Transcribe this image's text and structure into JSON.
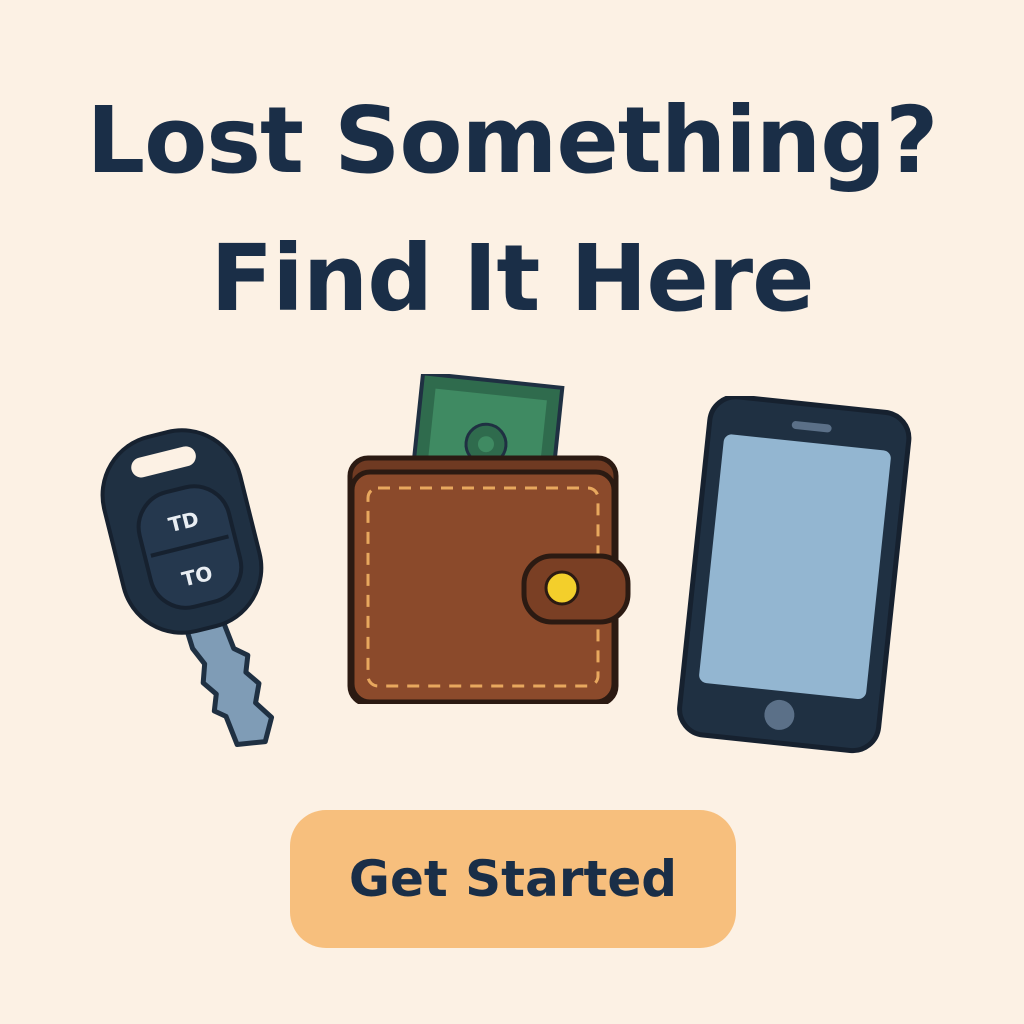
{
  "hero": {
    "title_line_1": "Lost Something?",
    "title_line_2": "Find It Here"
  },
  "illustration": {
    "items": [
      {
        "icon": "car-key-icon"
      },
      {
        "icon": "wallet-icon"
      },
      {
        "icon": "smartphone-icon"
      }
    ],
    "key_fob_button_top": "TD",
    "key_fob_button_bottom": "TO"
  },
  "cta": {
    "label": "Get Started"
  },
  "colors": {
    "background": "#fcf1e4",
    "headline": "#1a2e47",
    "button": "#f7bf7d",
    "wallet": "#8b4a2b",
    "banknote": "#2f6b4d",
    "phone_screen": "#93b6d1"
  }
}
